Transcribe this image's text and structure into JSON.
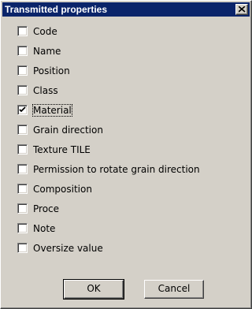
{
  "window": {
    "title": "Transmitted properties",
    "titlebar_color": "#0a246a"
  },
  "options": [
    {
      "label": "Code",
      "checked": false
    },
    {
      "label": "Name",
      "checked": false
    },
    {
      "label": "Position",
      "checked": false
    },
    {
      "label": "Class",
      "checked": false
    },
    {
      "label": "Material",
      "checked": true
    },
    {
      "label": "Grain direction",
      "checked": false
    },
    {
      "label": "Texture TILE",
      "checked": false
    },
    {
      "label": "Permission to rotate grain direction",
      "checked": false
    },
    {
      "label": "Composition",
      "checked": false
    },
    {
      "label": "Proce",
      "checked": false
    },
    {
      "label": "Note",
      "checked": false
    },
    {
      "label": "Oversize value",
      "checked": false
    }
  ],
  "buttons": {
    "ok_label": "OK",
    "cancel_label": "Cancel"
  },
  "icons": {
    "close": "close-icon",
    "check": "checkmark-icon"
  }
}
